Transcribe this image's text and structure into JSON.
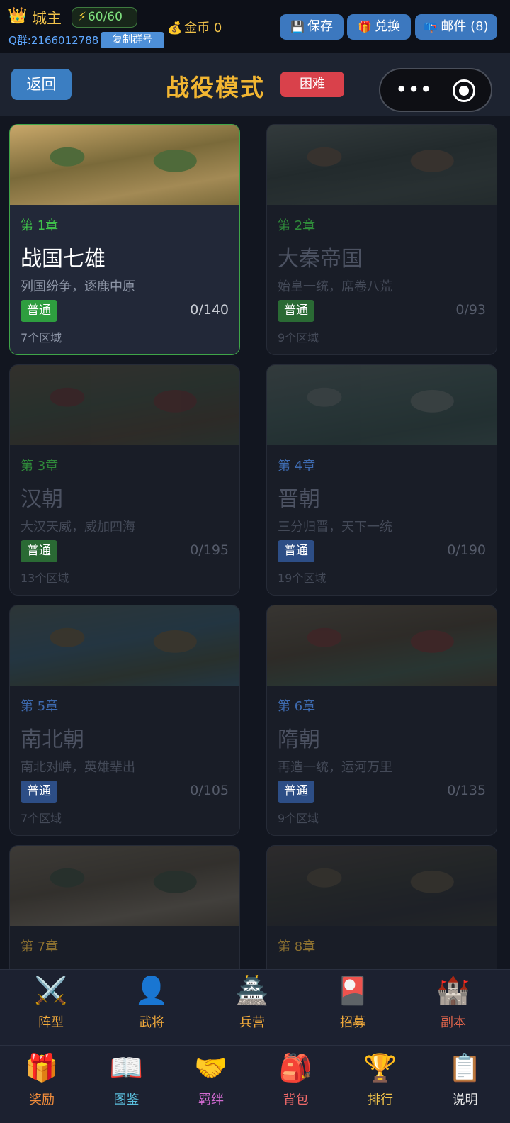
{
  "topbar": {
    "player_name": "城主",
    "energy": "60/60",
    "qq_group": "Q群:2166012788",
    "copy_button": "复制群号",
    "gold": "金币 0",
    "save_label": "保存",
    "exchange_label": "兑换",
    "mail_label": "邮件 (8)"
  },
  "header": {
    "back_label": "返回",
    "title": "战役模式",
    "difficulty": "困难"
  },
  "chapters": [
    {
      "chapter": "第 1章",
      "name": "战国七雄",
      "desc": "列国纷争，逐鹿中原",
      "tag": "普通",
      "progress": "0/140",
      "regions": "7个区域",
      "state": "active",
      "tag_color": "#2e9e3f",
      "chapter_color": "#3fbf4a"
    },
    {
      "chapter": "第 2章",
      "name": "大秦帝国",
      "desc": "始皇一统，席卷八荒",
      "tag": "普通",
      "progress": "0/93",
      "regions": "9个区域",
      "state": "locked",
      "tag_color": "#2a6a34",
      "chapter_color": "#2f8a3a"
    },
    {
      "chapter": "第 3章",
      "name": "汉朝",
      "desc": "大汉天威，威加四海",
      "tag": "普通",
      "progress": "0/195",
      "regions": "13个区域",
      "state": "locked",
      "tag_color": "#2a6a34",
      "chapter_color": "#2f8a3a"
    },
    {
      "chapter": "第 4章",
      "name": "晋朝",
      "desc": "三分归晋，天下一统",
      "tag": "普通",
      "progress": "0/190",
      "regions": "19个区域",
      "state": "locked",
      "tag_color": "#2d4e86",
      "chapter_color": "#3e6bb0"
    },
    {
      "chapter": "第 5章",
      "name": "南北朝",
      "desc": "南北对峙，英雄辈出",
      "tag": "普通",
      "progress": "0/105",
      "regions": "7个区域",
      "state": "locked",
      "tag_color": "#2d4e86",
      "chapter_color": "#3e6bb0"
    },
    {
      "chapter": "第 6章",
      "name": "隋朝",
      "desc": "再造一统，运河万里",
      "tag": "普通",
      "progress": "0/135",
      "regions": "9个区域",
      "state": "locked",
      "tag_color": "#2d4e86",
      "chapter_color": "#3e6bb0"
    },
    {
      "chapter": "第 7章",
      "name": "",
      "desc": "",
      "tag": "",
      "progress": "",
      "regions": "",
      "state": "locked",
      "tag_color": "#6b5a2a",
      "chapter_color": "#8a6f30"
    },
    {
      "chapter": "第 8章",
      "name": "",
      "desc": "",
      "tag": "",
      "progress": "",
      "regions": "",
      "state": "locked",
      "tag_color": "#6b5a2a",
      "chapter_color": "#8a6f30"
    }
  ],
  "bottom_nav_row1": [
    {
      "label": "阵型",
      "icon": "crossed-swords-icon",
      "glyph": "⚔️",
      "color": "#f0a93b"
    },
    {
      "label": "武将",
      "icon": "person-icon",
      "glyph": "👤",
      "color": "#f0a93b"
    },
    {
      "label": "兵营",
      "icon": "castle-icon",
      "glyph": "🏯",
      "color": "#f0a93b"
    },
    {
      "label": "招募",
      "icon": "recruit-card-icon",
      "glyph": "🎴",
      "color": "#f0a93b"
    },
    {
      "label": "副本",
      "icon": "fortress-icon",
      "glyph": "🏰",
      "color": "#e0654b"
    }
  ],
  "bottom_nav_row2": [
    {
      "label": "奖励",
      "icon": "gift-icon",
      "glyph": "🎁",
      "color": "#f08c3b"
    },
    {
      "label": "图鉴",
      "icon": "book-icon",
      "glyph": "📖",
      "color": "#5bc0de"
    },
    {
      "label": "羁绊",
      "icon": "handshake-icon",
      "glyph": "🤝",
      "color": "#d06ad0"
    },
    {
      "label": "背包",
      "icon": "backpack-icon",
      "glyph": "🎒",
      "color": "#f06a6a"
    },
    {
      "label": "排行",
      "icon": "trophy-icon",
      "glyph": "🏆",
      "color": "#f0c24a"
    },
    {
      "label": "说明",
      "icon": "clipboard-icon",
      "glyph": "📋",
      "color": "#e6e6e6"
    }
  ]
}
